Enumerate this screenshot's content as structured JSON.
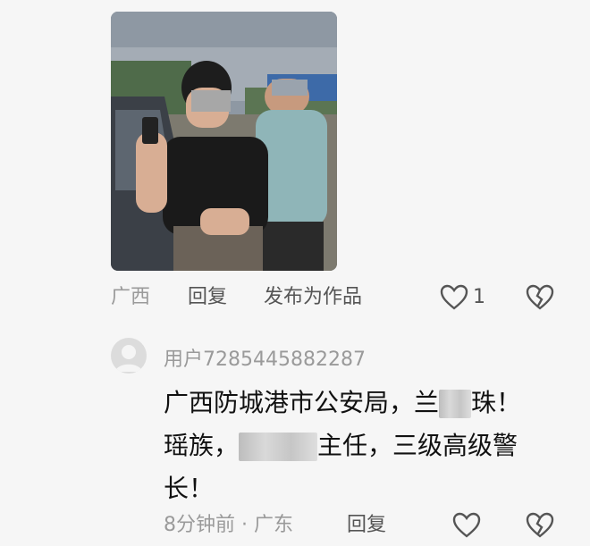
{
  "post": {
    "location": "广西",
    "reply_label": "回复",
    "publish_label": "发布为作品",
    "like_count": "1"
  },
  "comment": {
    "username": "用户7285445882287",
    "line1_a": "广西防城港市公安局，兰",
    "line1_b": "珠！",
    "line2_a": "瑶族，",
    "line2_b": "主任，三级高级警",
    "line3": "长！",
    "time_location": "8分钟前 · 广东",
    "reply_label": "回复"
  },
  "icons": {
    "like": "heart-outline-icon",
    "dislike": "broken-heart-icon",
    "avatar": "default-avatar-icon"
  },
  "colors": {
    "background": "#f6f6f6",
    "text_primary": "#111111",
    "text_secondary": "#555555",
    "text_muted": "#9a9a9a"
  }
}
